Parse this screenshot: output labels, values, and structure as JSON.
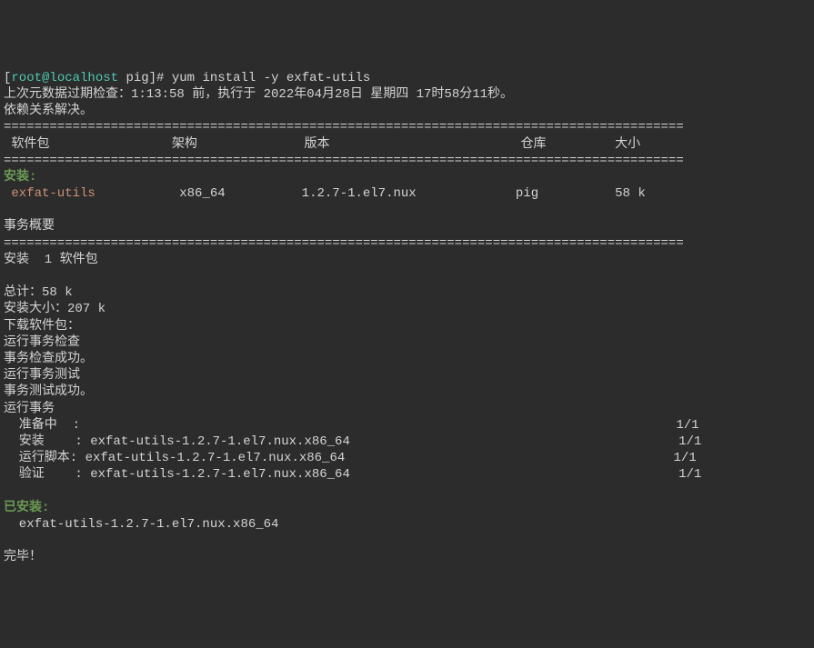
{
  "prompt": {
    "bracket_open": "[",
    "user_host": "root@localhost",
    "separator": " ",
    "dir": "pig",
    "bracket_close": "]#",
    "command": " yum install -y exfat-utils"
  },
  "lines": {
    "metadata": "上次元数据过期检查：1:13:58 前，执行于 2022年04月28日 星期四 17时58分11秒。",
    "deps_resolved": "依赖关系解决。",
    "separator_dbl": "=========================================================================================",
    "header": " 软件包                架构              版本                         仓库         大小",
    "installing": "安装:",
    "pkg_line": {
      "name": " exfat-utils",
      "middle": "           x86_64          1.2.7-1.el7.nux             pig          58 k"
    },
    "tx_summary": "事务概要",
    "install_pkg": "安装  1 软件包",
    "total": "总计：58 k",
    "install_size": "安装大小：207 k",
    "downloading": "下载软件包：",
    "run_check": "运行事务检查",
    "check_success": "事务检查成功。",
    "run_test": "运行事务测试",
    "test_success": "事务测试成功。",
    "run_tx": "运行事务",
    "prepare_left": "  准备中  :",
    "prepare_right": "                                                                              1/1",
    "install_left": "  安装    : exfat-utils-1.2.7-1.el7.nux.x86_64",
    "install_right": "                                           1/1",
    "script_left": "  运行脚本: exfat-utils-1.2.7-1.el7.nux.x86_64",
    "script_right": "                                           1/1",
    "verify_left": "  验证    : exfat-utils-1.2.7-1.el7.nux.x86_64",
    "verify_right": "                                           1/1",
    "installed_label": "已安装:",
    "installed_pkg": "  exfat-utils-1.2.7-1.el7.nux.x86_64",
    "done": "完毕！"
  }
}
